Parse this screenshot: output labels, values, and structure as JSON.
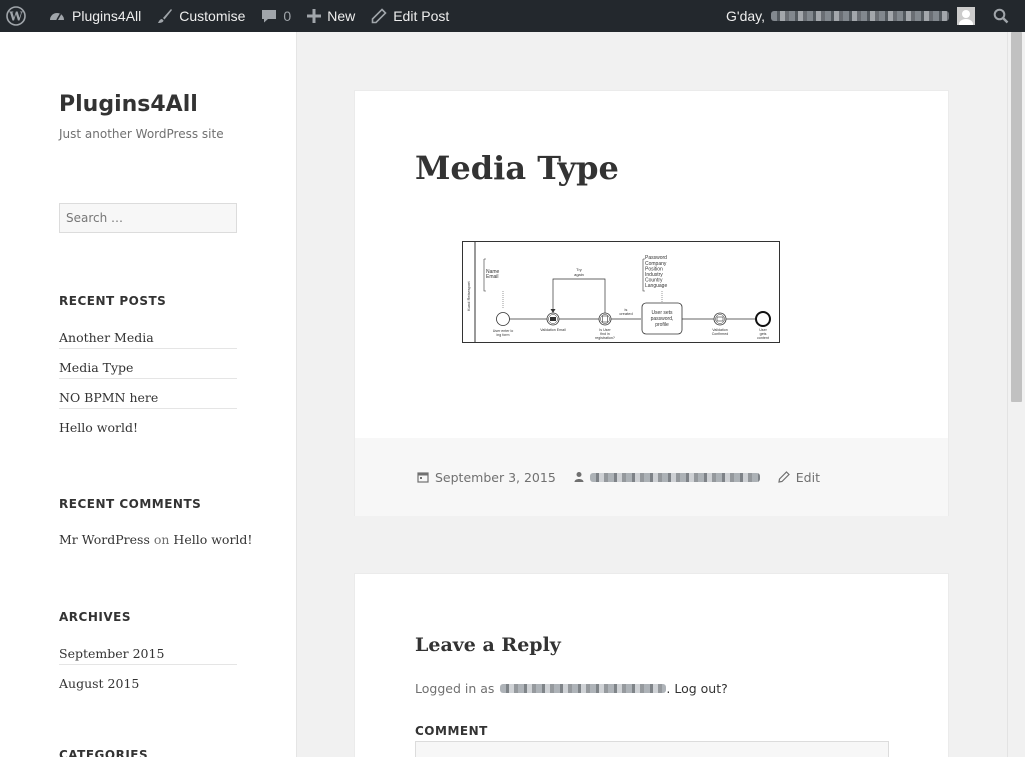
{
  "adminbar": {
    "site_name": "Plugins4All",
    "customise": "Customise",
    "comments_count": "0",
    "new": "New",
    "edit_post": "Edit Post",
    "greeting": "G'day,"
  },
  "sidebar": {
    "site_title": "Plugins4All",
    "site_description": "Just another WordPress site",
    "search_placeholder": "Search …",
    "recent_posts_title": "RECENT POSTS",
    "recent_posts": [
      "Another Media",
      "Media Type",
      "NO BPMN here",
      "Hello world!"
    ],
    "recent_comments_title": "RECENT COMMENTS",
    "recent_comment": {
      "author": "Mr WordPress",
      "on": "on",
      "post": "Hello world!"
    },
    "archives_title": "ARCHIVES",
    "archives": [
      "September 2015",
      "August 2015"
    ],
    "categories_title": "CATEGORIES"
  },
  "article": {
    "title": "Media Type",
    "date": "September 3, 2015",
    "edit": "Edit",
    "diagram": {
      "data_top": [
        "Name",
        "Email"
      ],
      "data_right": [
        "Password",
        "Company",
        "Position",
        "Industry",
        "Country",
        "Language"
      ],
      "loop_label": [
        "Try",
        "again"
      ],
      "yes_label": [
        "is",
        "created"
      ],
      "labels": {
        "start": [
          "User enter lo",
          "ing form"
        ],
        "validation": [
          "Validation Email"
        ],
        "check": [
          "Is User",
          "find in",
          "registration?"
        ],
        "task": [
          "User sets",
          "password,",
          "profile"
        ],
        "confirm": [
          "Validation",
          "Confirmed"
        ],
        "end": [
          "User",
          "gets",
          "content"
        ]
      },
      "lane": "Kund Reisesport"
    }
  },
  "comments": {
    "title": "Leave a Reply",
    "logged_in_as": "Logged in as",
    "logout": ". Log out?",
    "comment_label": "COMMENT"
  }
}
